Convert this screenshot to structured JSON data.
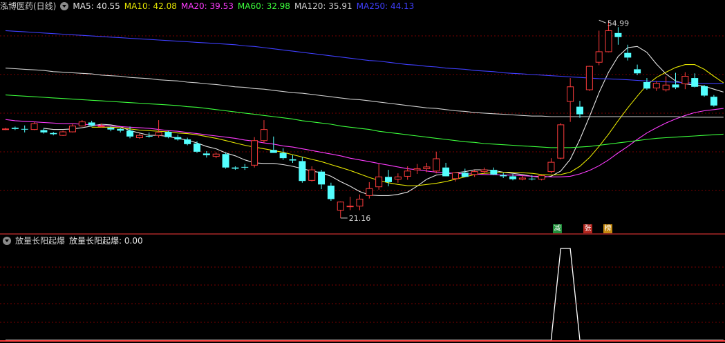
{
  "header": {
    "stock_name": "泓博医药(日线)",
    "ma_items": [
      {
        "label": "MA5: 40.55",
        "color": "#e6e6e6"
      },
      {
        "label": "MA10: 42.08",
        "color": "#e6e600"
      },
      {
        "label": "MA20: 39.53",
        "color": "#ff3cff"
      },
      {
        "label": "MA60: 32.98",
        "color": "#3cff3c"
      },
      {
        "label": "MA120: 35.91",
        "color": "#cfcfcf"
      },
      {
        "label": "MA250: 44.13",
        "color": "#3f3fff"
      }
    ]
  },
  "indicator": {
    "name": "放量长阳起爆",
    "value_label": "放量长阳起爆: 0.00"
  },
  "tags": [
    {
      "text": "减",
      "bg": "#1f8f3a"
    },
    {
      "text": "张",
      "bg": "#b3261e"
    },
    {
      "text": "榜",
      "bg": "#c58a10"
    }
  ],
  "colors": {
    "up": "#ff3c3c",
    "down": "#54ffff",
    "grid": "#7a0000",
    "signal": "#ffffff",
    "baseline": "#ff3c3c"
  },
  "chart_data": [
    {
      "type": "candlestick",
      "title": "泓博医药(日线)",
      "ylim": [
        19.5,
        57.5
      ],
      "annotations": [
        {
          "label": "54.99",
          "bar_index": 62,
          "value": 54.99
        },
        {
          "label": "21.16",
          "bar_index": 35,
          "value": 21.16
        }
      ],
      "candles": [
        [
          36.4,
          36.6,
          36.2,
          36.4
        ],
        [
          36.6,
          36.8,
          36.2,
          36.4
        ],
        [
          36.4,
          37.0,
          35.8,
          36.3
        ],
        [
          36.3,
          37.6,
          36.2,
          37.3
        ],
        [
          36.2,
          36.6,
          35.6,
          35.8
        ],
        [
          35.7,
          35.9,
          35.3,
          35.5
        ],
        [
          35.3,
          36.1,
          35.2,
          35.9
        ],
        [
          35.9,
          37.3,
          35.8,
          36.9
        ],
        [
          36.9,
          37.9,
          36.8,
          37.6
        ],
        [
          37.5,
          37.8,
          36.8,
          37.0
        ],
        [
          36.9,
          37.3,
          36.6,
          36.9
        ],
        [
          36.6,
          36.8,
          36.0,
          36.3
        ],
        [
          36.4,
          36.6,
          35.8,
          36.1
        ],
        [
          36.1,
          36.8,
          34.8,
          35.1
        ],
        [
          34.9,
          35.6,
          34.7,
          35.3
        ],
        [
          35.2,
          35.8,
          34.9,
          35.1
        ],
        [
          35.3,
          37.9,
          34.9,
          35.8
        ],
        [
          35.9,
          36.1,
          34.8,
          35.0
        ],
        [
          35.0,
          35.4,
          34.4,
          34.6
        ],
        [
          34.6,
          34.9,
          33.6,
          33.8
        ],
        [
          33.9,
          34.3,
          32.3,
          32.5
        ],
        [
          32.2,
          32.6,
          31.5,
          31.9
        ],
        [
          31.7,
          32.4,
          31.4,
          32.1
        ],
        [
          32.1,
          32.4,
          29.6,
          29.8
        ],
        [
          29.8,
          30.0,
          29.4,
          29.6
        ],
        [
          29.9,
          30.4,
          29.4,
          29.8
        ],
        [
          30.2,
          35.0,
          29.8,
          34.4
        ],
        [
          34.4,
          37.9,
          34.0,
          36.3
        ],
        [
          32.8,
          35.1,
          32.4,
          32.3
        ],
        [
          32.3,
          33.1,
          31.1,
          31.4
        ],
        [
          31.2,
          31.9,
          30.6,
          31.0
        ],
        [
          30.9,
          31.6,
          27.2,
          27.5
        ],
        [
          27.6,
          30.0,
          27.4,
          29.4
        ],
        [
          29.1,
          29.4,
          26.1,
          26.9
        ],
        [
          26.7,
          27.2,
          24.1,
          24.4
        ],
        [
          22.5,
          24.0,
          21.16,
          23.9
        ],
        [
          23.2,
          24.8,
          22.5,
          23.2
        ],
        [
          23.2,
          25.2,
          22.5,
          24.4
        ],
        [
          25.0,
          27.3,
          24.5,
          26.2
        ],
        [
          26.5,
          30.4,
          26.0,
          28.2
        ],
        [
          28.2,
          29.4,
          26.6,
          27.3
        ],
        [
          27.8,
          28.8,
          27.2,
          28.2
        ],
        [
          28.3,
          30.0,
          27.7,
          29.2
        ],
        [
          29.4,
          30.4,
          28.7,
          29.6
        ],
        [
          29.6,
          30.6,
          29.0,
          29.9
        ],
        [
          29.2,
          32.5,
          28.8,
          31.3
        ],
        [
          29.8,
          30.6,
          28.8,
          28.3
        ],
        [
          27.9,
          28.8,
          27.4,
          28.9
        ],
        [
          28.9,
          29.6,
          28.5,
          28.2
        ],
        [
          28.6,
          29.4,
          28.2,
          29.1
        ],
        [
          29.1,
          29.8,
          28.7,
          29.4
        ],
        [
          29.4,
          29.8,
          28.5,
          28.6
        ],
        [
          28.5,
          28.9,
          28.0,
          28.3
        ],
        [
          28.3,
          28.7,
          27.6,
          27.8
        ],
        [
          27.8,
          28.4,
          27.6,
          28.0
        ],
        [
          27.9,
          28.5,
          27.6,
          27.8
        ],
        [
          27.8,
          28.5,
          27.6,
          28.4
        ],
        [
          29.1,
          31.4,
          28.8,
          30.7
        ],
        [
          31.4,
          37.4,
          31.2,
          37.1
        ],
        [
          41.1,
          45.1,
          37.6,
          43.6
        ],
        [
          40.2,
          41.2,
          38.3,
          38.9
        ],
        [
          43.1,
          47.2,
          42.9,
          47.1
        ],
        [
          47.8,
          53.2,
          47.3,
          49.6
        ],
        [
          49.6,
          54.99,
          49.5,
          53.2
        ],
        [
          52.8,
          53.8,
          50.8,
          52.1
        ],
        [
          49.4,
          50.8,
          48.1,
          48.6
        ],
        [
          46.6,
          47.4,
          45.6,
          45.9
        ],
        [
          44.4,
          45.1,
          43.1,
          43.3
        ],
        [
          43.4,
          44.6,
          42.9,
          44.2
        ],
        [
          43.1,
          45.4,
          42.8,
          43.9
        ],
        [
          44.0,
          46.0,
          43.2,
          43.5
        ],
        [
          44.1,
          46.1,
          43.2,
          45.4
        ],
        [
          45.1,
          45.9,
          43.5,
          43.6
        ],
        [
          43.7,
          43.9,
          41.9,
          42.1
        ],
        [
          41.9,
          42.2,
          40.2,
          40.4
        ]
      ],
      "series": [
        {
          "name": "MA5",
          "color": "#e6e6e6",
          "values": [
            null,
            null,
            null,
            null,
            36.5,
            36.3,
            36.3,
            36.4,
            36.6,
            36.9,
            37.2,
            37.1,
            36.8,
            36.1,
            35.7,
            35.3,
            35.3,
            35.1,
            34.8,
            34.5,
            34.0,
            33.4,
            33.0,
            32.3,
            31.8,
            31.1,
            30.6,
            30.5,
            30.5,
            30.3,
            30.0,
            29.6,
            29.2,
            28.9,
            28.3,
            27.4,
            26.6,
            25.7,
            25.1,
            25.0,
            25.0,
            25.2,
            25.6,
            26.6,
            27.8,
            28.5,
            28.7,
            28.9,
            29.1,
            29.4,
            29.4,
            29.3,
            29.0,
            28.8,
            28.6,
            28.3,
            28.1,
            28.3,
            29.2,
            31.2,
            34.6,
            38.5,
            42.6,
            46.1,
            48.8,
            50.3,
            50.5,
            49.5,
            47.5,
            45.8,
            44.6,
            44.1,
            43.9,
            43.7,
            43.2,
            42.7
          ]
        },
        {
          "name": "MA10",
          "color": "#e6e600",
          "values": [
            null,
            null,
            null,
            null,
            null,
            null,
            null,
            null,
            null,
            36.7,
            36.7,
            36.7,
            36.6,
            36.4,
            36.2,
            36.1,
            36.0,
            35.9,
            35.7,
            35.6,
            35.4,
            35.1,
            34.8,
            34.4,
            34.0,
            33.6,
            33.3,
            33.0,
            32.7,
            32.4,
            32.0,
            31.6,
            31.2,
            30.8,
            30.3,
            29.8,
            29.3,
            28.7,
            28.1,
            27.6,
            27.2,
            26.9,
            26.7,
            26.7,
            26.9,
            27.1,
            27.4,
            27.8,
            28.2,
            28.6,
            28.8,
            28.9,
            29.0,
            29.0,
            28.9,
            28.8,
            28.6,
            28.5,
            28.6,
            29.0,
            30.0,
            31.5,
            33.4,
            35.5,
            37.8,
            40.0,
            42.0,
            43.9,
            45.2,
            46.1,
            46.9,
            47.4,
            47.4,
            46.6,
            45.4,
            44.3
          ]
        },
        {
          "name": "MA20",
          "color": "#ff3cff",
          "values": [
            38.0,
            37.8,
            37.7,
            37.6,
            37.5,
            37.4,
            37.3,
            37.3,
            37.2,
            37.1,
            37.0,
            36.9,
            36.8,
            36.7,
            36.6,
            36.5,
            36.3,
            36.1,
            36.0,
            35.8,
            35.6,
            35.4,
            35.2,
            35.0,
            34.8,
            34.5,
            34.3,
            34.0,
            33.8,
            33.5,
            33.3,
            33.0,
            32.7,
            32.4,
            32.1,
            31.8,
            31.4,
            31.1,
            30.8,
            30.5,
            30.2,
            29.9,
            29.6,
            29.4,
            29.2,
            29.0,
            28.9,
            28.8,
            28.7,
            28.7,
            28.6,
            28.6,
            28.5,
            28.5,
            28.4,
            28.3,
            28.3,
            28.2,
            28.2,
            28.3,
            28.7,
            29.3,
            30.1,
            31.1,
            32.3,
            33.4,
            34.6,
            35.7,
            36.6,
            37.4,
            38.1,
            38.7,
            39.2,
            39.5,
            39.7,
            39.9
          ]
        },
        {
          "name": "MA60",
          "color": "#3cff3c",
          "values": [
            42.2,
            42.1,
            42.0,
            41.9,
            41.8,
            41.7,
            41.6,
            41.5,
            41.4,
            41.3,
            41.2,
            41.1,
            41.0,
            40.9,
            40.8,
            40.7,
            40.6,
            40.5,
            40.4,
            40.2,
            40.1,
            39.9,
            39.7,
            39.5,
            39.3,
            39.1,
            38.9,
            38.7,
            38.5,
            38.3,
            38.1,
            37.8,
            37.6,
            37.4,
            37.2,
            36.9,
            36.7,
            36.5,
            36.3,
            36.0,
            35.8,
            35.6,
            35.4,
            35.2,
            35.0,
            34.8,
            34.6,
            34.4,
            34.2,
            34.1,
            33.9,
            33.8,
            33.7,
            33.6,
            33.5,
            33.4,
            33.3,
            33.2,
            33.2,
            33.2,
            33.3,
            33.4,
            33.6,
            33.8,
            34.0,
            34.2,
            34.4,
            34.6,
            34.8,
            34.9,
            35.0,
            35.1,
            35.2,
            35.3,
            35.4,
            35.5
          ]
        },
        {
          "name": "MA120",
          "color": "#cfcfcf",
          "values": [
            46.8,
            46.7,
            46.6,
            46.5,
            46.4,
            46.2,
            46.1,
            46.0,
            45.9,
            45.8,
            45.6,
            45.5,
            45.4,
            45.2,
            45.1,
            45.0,
            44.8,
            44.7,
            44.6,
            44.4,
            44.3,
            44.1,
            44.0,
            43.8,
            43.6,
            43.5,
            43.3,
            43.2,
            43.0,
            42.8,
            42.6,
            42.5,
            42.3,
            42.1,
            41.9,
            41.7,
            41.5,
            41.4,
            41.2,
            41.0,
            40.8,
            40.6,
            40.4,
            40.2,
            40.0,
            39.9,
            39.7,
            39.5,
            39.4,
            39.2,
            39.1,
            39.0,
            38.9,
            38.8,
            38.7,
            38.6,
            38.6,
            38.5,
            38.5,
            38.5,
            38.5,
            38.5,
            38.5,
            38.5,
            38.5,
            38.5,
            38.5,
            38.5,
            38.5,
            38.5,
            38.5,
            38.4,
            38.4,
            38.4,
            38.4,
            38.4
          ]
        },
        {
          "name": "MA250",
          "color": "#3f3fff",
          "values": [
            53.2,
            53.1,
            53.0,
            52.9,
            52.8,
            52.7,
            52.6,
            52.5,
            52.4,
            52.3,
            52.2,
            52.1,
            52.0,
            51.9,
            51.8,
            51.7,
            51.6,
            51.5,
            51.4,
            51.3,
            51.2,
            51.1,
            51.0,
            50.9,
            50.8,
            50.6,
            50.5,
            50.3,
            50.1,
            49.9,
            49.7,
            49.5,
            49.3,
            49.1,
            48.9,
            48.7,
            48.5,
            48.3,
            48.1,
            48.0,
            47.8,
            47.6,
            47.4,
            47.3,
            47.1,
            47.0,
            46.8,
            46.7,
            46.6,
            46.4,
            46.3,
            46.2,
            46.0,
            45.9,
            45.8,
            45.7,
            45.6,
            45.5,
            45.4,
            45.3,
            45.2,
            45.1,
            45.0,
            44.95,
            44.9,
            44.8,
            44.7,
            44.6,
            44.5,
            44.45,
            44.4,
            44.3,
            44.25,
            44.2,
            44.15,
            44.13
          ]
        }
      ]
    },
    {
      "type": "line",
      "title": "放量长阳起爆",
      "ylim": [
        0,
        1
      ],
      "series": [
        {
          "name": "放量长阳起爆",
          "values": [
            0,
            0,
            0,
            0,
            0,
            0,
            0,
            0,
            0,
            0,
            0,
            0,
            0,
            0,
            0,
            0,
            0,
            0,
            0,
            0,
            0,
            0,
            0,
            0,
            0,
            0,
            0,
            0,
            0,
            0,
            0,
            0,
            0,
            0,
            0,
            0,
            0,
            0,
            0,
            0,
            0,
            0,
            0,
            0,
            0,
            0,
            0,
            0,
            0,
            0,
            0,
            0,
            0,
            0,
            0,
            0,
            0,
            0,
            1,
            1,
            0,
            0,
            0,
            0,
            0,
            0,
            0,
            0,
            0,
            0,
            0,
            0,
            0,
            0,
            0,
            0
          ]
        }
      ]
    }
  ]
}
